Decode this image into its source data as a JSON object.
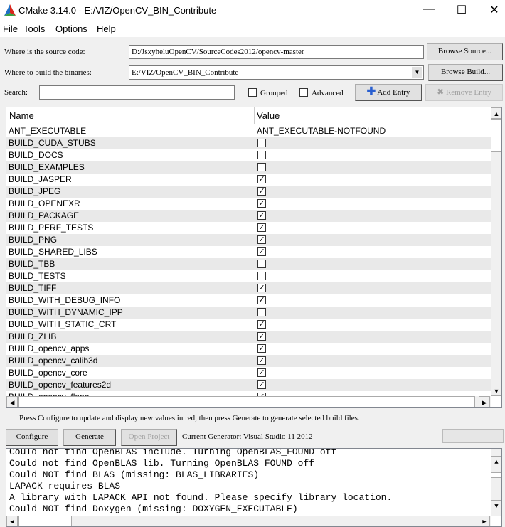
{
  "window": {
    "title": "CMake 3.14.0 - E:/VIZ/OpenCV_BIN_Contribute",
    "minimize": "—",
    "maximize": "☐",
    "close": "✕"
  },
  "menu": [
    "File",
    "Tools",
    "Options",
    "Help"
  ],
  "source": {
    "label": "Where is the source code:",
    "value": "D:/JsxyheluOpenCV/SourceCodes2012/opencv-master",
    "browse": "Browse Source..."
  },
  "build": {
    "label": "Where to build the binaries:",
    "value": "E:/VIZ/OpenCV_BIN_Contribute",
    "browse": "Browse Build..."
  },
  "search": {
    "label": "Search:",
    "value": ""
  },
  "options": {
    "grouped": "Grouped",
    "grouped_checked": false,
    "advanced": "Advanced",
    "advanced_checked": false,
    "add_entry": "Add Entry",
    "remove_entry": "Remove Entry"
  },
  "table": {
    "headers": [
      "Name",
      "Value"
    ],
    "rows": [
      {
        "name": "ANT_EXECUTABLE",
        "value": "ANT_EXECUTABLE-NOTFOUND"
      },
      {
        "name": "BUILD_CUDA_STUBS",
        "checked": false
      },
      {
        "name": "BUILD_DOCS",
        "checked": false
      },
      {
        "name": "BUILD_EXAMPLES",
        "checked": false
      },
      {
        "name": "BUILD_JASPER",
        "checked": true
      },
      {
        "name": "BUILD_JPEG",
        "checked": true
      },
      {
        "name": "BUILD_OPENEXR",
        "checked": true
      },
      {
        "name": "BUILD_PACKAGE",
        "checked": true
      },
      {
        "name": "BUILD_PERF_TESTS",
        "checked": true
      },
      {
        "name": "BUILD_PNG",
        "checked": true
      },
      {
        "name": "BUILD_SHARED_LIBS",
        "checked": true
      },
      {
        "name": "BUILD_TBB",
        "checked": false
      },
      {
        "name": "BUILD_TESTS",
        "checked": false
      },
      {
        "name": "BUILD_TIFF",
        "checked": true
      },
      {
        "name": "BUILD_WITH_DEBUG_INFO",
        "checked": true
      },
      {
        "name": "BUILD_WITH_DYNAMIC_IPP",
        "checked": false
      },
      {
        "name": "BUILD_WITH_STATIC_CRT",
        "checked": true
      },
      {
        "name": "BUILD_ZLIB",
        "checked": true
      },
      {
        "name": "BUILD_opencv_apps",
        "checked": true
      },
      {
        "name": "BUILD_opencv_calib3d",
        "checked": true
      },
      {
        "name": "BUILD_opencv_core",
        "checked": true
      },
      {
        "name": "BUILD_opencv_features2d",
        "checked": true
      },
      {
        "name": "BUILD_opencv_flann",
        "checked": true
      }
    ]
  },
  "hint": "Press Configure to update and display new values in red, then press Generate to generate selected build files.",
  "actions": {
    "configure": "Configure",
    "generate": "Generate",
    "open_project": "Open Project",
    "generator": "Current Generator: Visual Studio 11 2012"
  },
  "log": [
    "Could not find OpenBLAS include. Turning OpenBLAS_FOUND off",
    "Could not find OpenBLAS lib. Turning OpenBLAS_FOUND off",
    "Could NOT find BLAS (missing: BLAS_LIBRARIES)",
    "LAPACK requires BLAS",
    "A library with LAPACK API not found. Please specify library location.",
    "Could NOT find Doxygen (missing: DOXYGEN_EXECUTABLE)"
  ]
}
